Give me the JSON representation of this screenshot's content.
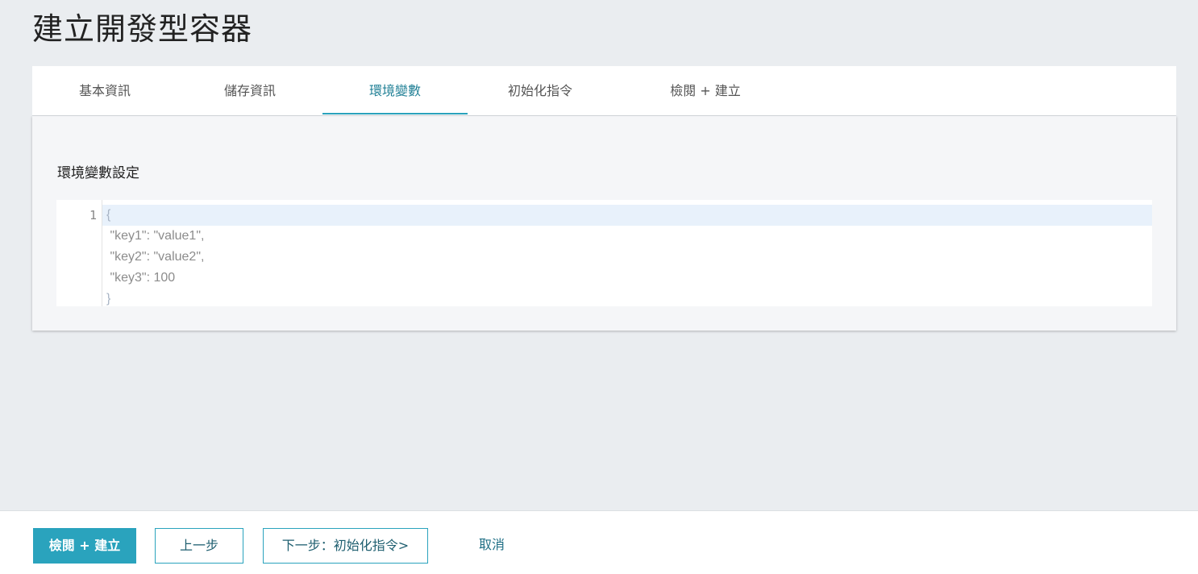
{
  "page": {
    "title": "建立開發型容器"
  },
  "tabs": [
    {
      "label": "基本資訊",
      "active": false
    },
    {
      "label": "儲存資訊",
      "active": false
    },
    {
      "label": "環境變數",
      "active": true
    },
    {
      "label": "初始化指令",
      "active": false
    },
    {
      "label": "檢閱 + 建立",
      "active": false
    }
  ],
  "panel": {
    "section_title": "環境變數設定",
    "editor": {
      "line_number": "1",
      "lines": [
        "{",
        " \"key1\": \"value1\",",
        " \"key2\": \"value2\",",
        " \"key3\": 100",
        "}"
      ]
    }
  },
  "footer": {
    "review_create_label": "檢閱 + 建立",
    "prev_label": "上一步",
    "next_label": "下一步：初始化指令>",
    "cancel_label": "取消"
  },
  "colors": {
    "accent": "#2aa3bd",
    "active_tab_text": "#1f7f95",
    "background": "#eaedf0",
    "active_line": "#e8f1fb"
  }
}
